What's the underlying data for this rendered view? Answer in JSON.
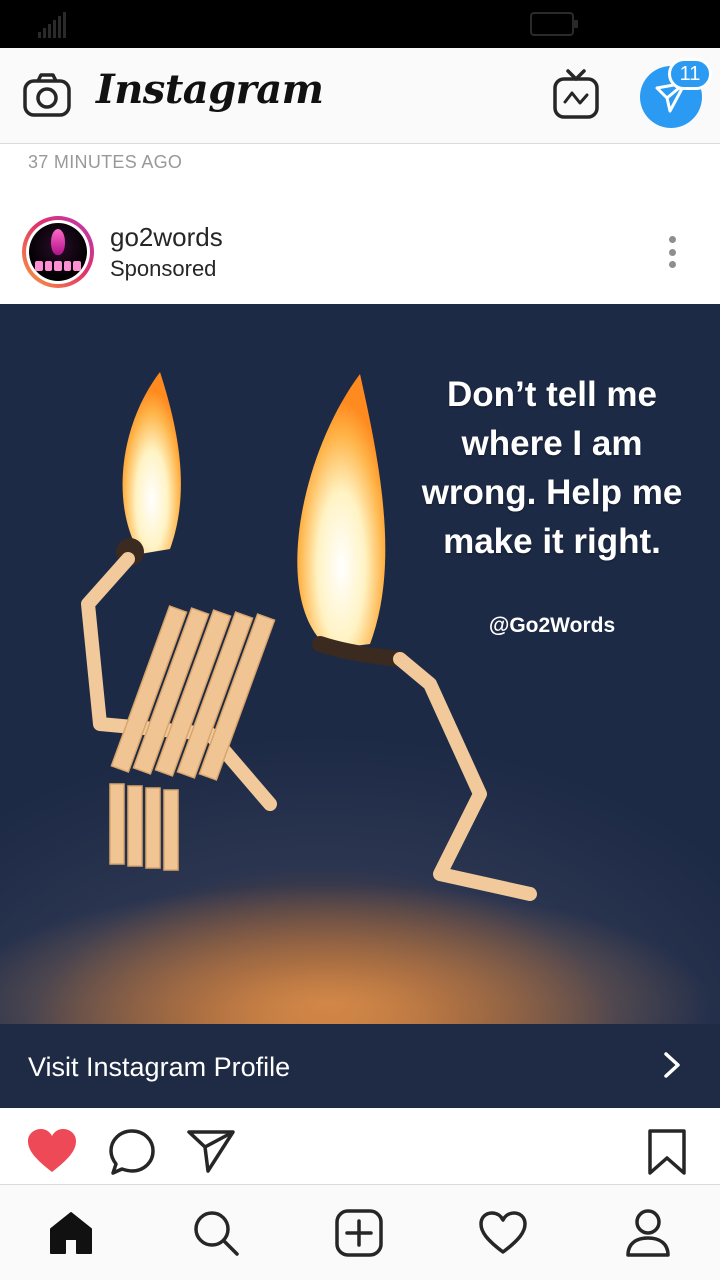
{
  "app": {
    "logo_text": "Instagram"
  },
  "header": {
    "direct_badge_count": "11",
    "icons": [
      "camera-icon",
      "igtv-icon",
      "direct-message-icon"
    ]
  },
  "feed": {
    "timestamp": "37 MINUTES AGO",
    "post": {
      "username": "go2words",
      "subtitle": "Sponsored",
      "image": {
        "quote_lines": [
          "Don’t tell me",
          "where I am",
          "wrong. Help me",
          "make it right."
        ],
        "handle": "@Go2Words"
      },
      "cta_label": "Visit Instagram Profile",
      "actions": [
        "like-icon",
        "comment-icon",
        "share-icon",
        "save-icon"
      ],
      "liked": true
    }
  },
  "bottom_nav": [
    "home-icon",
    "search-icon",
    "new-post-icon",
    "activity-icon",
    "profile-icon"
  ],
  "colors": {
    "accent_blue": "#2b9af3",
    "like_red": "#ed4956",
    "cta_background": "#1f2b45",
    "text_primary": "#262626",
    "text_secondary": "#999999"
  }
}
